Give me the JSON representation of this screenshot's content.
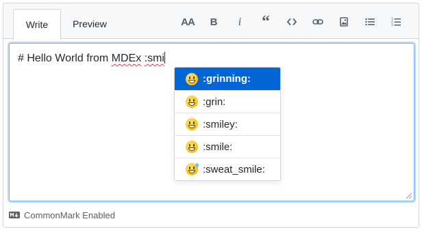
{
  "tabs": {
    "write_label": "Write",
    "preview_label": "Preview"
  },
  "toolbar": {
    "tools": [
      {
        "name": "text-size-icon",
        "glyph": "AA"
      },
      {
        "name": "bold-icon",
        "glyph": "B"
      },
      {
        "name": "italic-icon",
        "glyph": "i"
      },
      {
        "name": "quote-icon",
        "glyph": "“"
      },
      {
        "name": "code-icon",
        "glyph": "<>"
      },
      {
        "name": "link-icon",
        "glyph": ""
      },
      {
        "name": "image-icon",
        "glyph": ""
      },
      {
        "name": "unordered-list-icon",
        "glyph": ""
      },
      {
        "name": "ordered-list-icon",
        "glyph": ""
      }
    ]
  },
  "editor": {
    "text_before": "# Hello World from ",
    "text_misspelled_1": "MDEx",
    "text_space": " ",
    "text_misspelled_2": ":smi"
  },
  "suggestions": {
    "items": [
      {
        "label": ":grinning:",
        "emoji": "grinning-face-icon",
        "selected": true
      },
      {
        "label": ":grin:",
        "emoji": "grin-face-icon",
        "selected": false
      },
      {
        "label": ":smiley:",
        "emoji": "smiley-face-icon",
        "selected": false
      },
      {
        "label": ":smile:",
        "emoji": "smile-face-icon",
        "selected": false
      },
      {
        "label": ":sweat_smile:",
        "emoji": "sweat-smile-face-icon",
        "selected": false
      }
    ]
  },
  "footer": {
    "label": "CommonMark Enabled",
    "icon": "markdown-icon"
  },
  "colors": {
    "accent": "#0366d6",
    "focus_border": "#79b8ff",
    "header_bg": "#f6f8fa",
    "border": "#d1d5da",
    "spelling_error": "#d73a49"
  }
}
